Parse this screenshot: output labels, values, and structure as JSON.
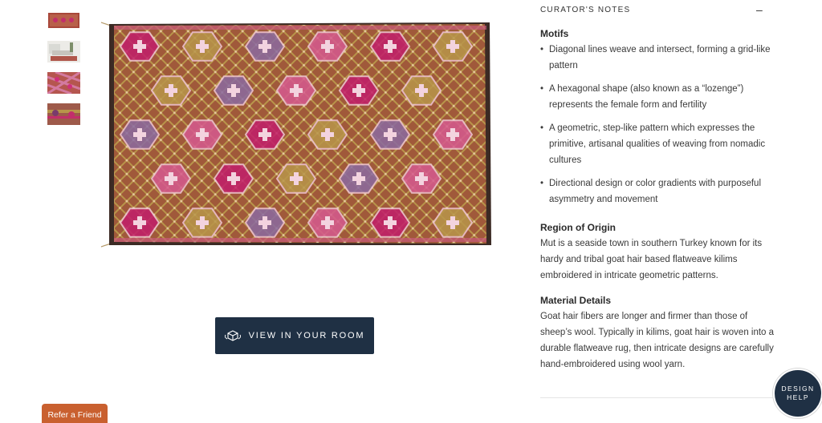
{
  "gallery": {
    "thumbnails": [
      {
        "name": "rug front view",
        "selected": true
      },
      {
        "name": "rug in room"
      },
      {
        "name": "rug close-up"
      },
      {
        "name": "rug detail"
      }
    ],
    "main_image": "rug-main-image"
  },
  "actions": {
    "view_in_room_label": "VIEW IN YOUR ROOM",
    "view_in_room_icon": "ar-cube-icon",
    "refer_label": "Refer a Friend",
    "design_help_line1": "DESIGN",
    "design_help_line2": "HELP"
  },
  "curator": {
    "heading": "CURATOR'S NOTES",
    "toggle": "–",
    "motifs_title": "Motifs",
    "motifs": [
      "Diagonal lines weave and intersect, forming a grid-like pattern",
      "A hexagonal shape (also known as a “lozenge”) represents the female form and fertility",
      "A geometric, step-like pattern which expresses the primitive, artisanal qualities of weaving from nomadic cultures",
      "Directional design or color gradients with purposeful asymmetry and movement"
    ],
    "region_title": "Region of Origin",
    "region_text": "Mut is a seaside town in southern Turkey known for its hardy and tribal goat hair based flatweave kilims embroidered in intricate geometric patterns.",
    "material_title": "Material Details",
    "material_text": "Goat hair fibers are longer and firmer than those of sheep’s wool. Typically in kilims, goat hair is woven into a durable flatweave rug, then intricate designs are carefully hand-embroidered using wool yarn."
  },
  "colors": {
    "navy": "#1f3044",
    "accent_orange": "#c9602f",
    "rug_base": "#a0593a",
    "rug_magenta": "#c21e6b",
    "rug_gold": "#b8954a"
  }
}
